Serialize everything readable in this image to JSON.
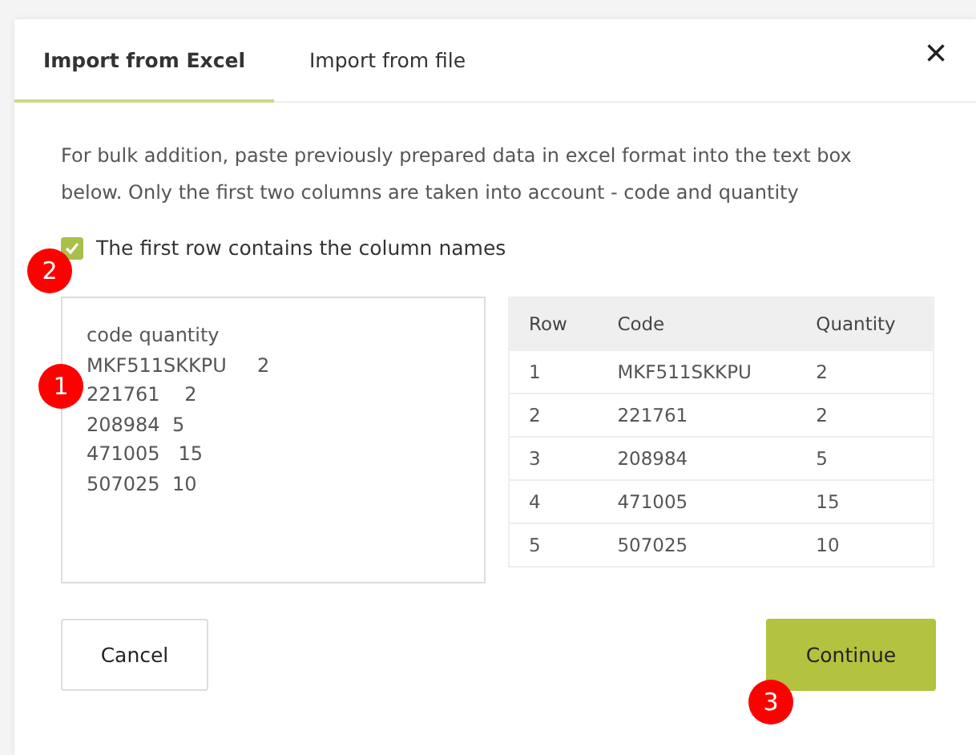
{
  "tabs": [
    {
      "label": "Import from Excel",
      "selected": true
    },
    {
      "label": "Import from file",
      "selected": false
    }
  ],
  "close": "×",
  "description": "For bulk addition, paste previously prepared data in excel format into the text box below. Only the first two columns are taken into account - code and quantity",
  "header_checkbox": {
    "label": "The first row contains the column names",
    "checked": true
  },
  "paste_box": {
    "lines": [
      "code quantity",
      "MKF511SKKPU     2",
      "221761    2",
      "208984  5",
      "471005   15",
      "507025  10"
    ]
  },
  "table": {
    "columns": [
      "Row",
      "Code",
      "Quantity"
    ],
    "rows": [
      [
        "1",
        "MKF511SKKPU",
        "2"
      ],
      [
        "2",
        "221761",
        "2"
      ],
      [
        "3",
        "208984",
        "5"
      ],
      [
        "4",
        "471005",
        "15"
      ],
      [
        "5",
        "507025",
        "10"
      ]
    ]
  },
  "buttons": [
    {
      "label": "Cancel",
      "kind": "secondary"
    },
    {
      "label": "Continue",
      "kind": "primary"
    }
  ],
  "markers": [
    "1",
    "2",
    "3"
  ]
}
